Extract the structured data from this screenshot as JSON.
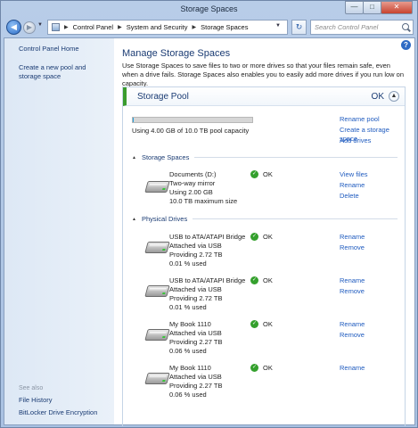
{
  "window": {
    "title": "Storage Spaces"
  },
  "address": {
    "crumbs": [
      "Control Panel",
      "System and Security",
      "Storage Spaces"
    ]
  },
  "search": {
    "placeholder": "Search Control Panel"
  },
  "left": {
    "home": "Control Panel Home",
    "create": "Create a new pool and storage space",
    "see_also": "See also",
    "file_history": "File History",
    "bitlocker": "BitLocker Drive Encryption"
  },
  "main": {
    "title": "Manage Storage Spaces",
    "description": "Use Storage Spaces to save files to two or more drives so that your files remain safe, even when a drive fails. Storage Spaces also enables you to easily add more drives if you run low on capacity."
  },
  "pool": {
    "title": "Storage Pool",
    "status": "OK",
    "capacity_text": "Using 4.00 GB of 10.0 TB pool capacity",
    "capacity_fraction": 0.0004,
    "actions": [
      "Rename pool",
      "Create a storage space",
      "Add drives"
    ]
  },
  "storage_spaces": {
    "header": "Storage Spaces",
    "items": [
      {
        "lines": [
          "Documents (D:)",
          "Two-way mirror",
          "Using 2.00 GB",
          "10.0 TB maximum size"
        ],
        "status": "OK",
        "actions": [
          "View files",
          "Rename",
          "Delete"
        ]
      }
    ]
  },
  "physical_drives": {
    "header": "Physical Drives",
    "items": [
      {
        "lines": [
          "USB to ATA/ATAPI Bridge",
          "Attached via USB",
          "Providing 2.72 TB",
          "0.01 % used"
        ],
        "status": "OK",
        "actions": [
          "Rename",
          "Remove"
        ]
      },
      {
        "lines": [
          "USB to ATA/ATAPI Bridge",
          "Attached via USB",
          "Providing 2.72 TB",
          "0.01 % used"
        ],
        "status": "OK",
        "actions": [
          "Rename",
          "Remove"
        ]
      },
      {
        "lines": [
          "My Book 1110",
          "Attached via USB",
          "Providing 2.27 TB",
          "0.06 % used"
        ],
        "status": "OK",
        "actions": [
          "Rename",
          "Remove"
        ]
      },
      {
        "lines": [
          "My Book 1110",
          "Attached via USB",
          "Providing 2.27 TB",
          "0.06 % used"
        ],
        "status": "OK",
        "actions": [
          "Rename"
        ]
      }
    ]
  },
  "colors": {
    "accent": "#3a9c2d",
    "link": "#1f5bbf",
    "heading": "#1a3b73",
    "progress": "#26a0da"
  },
  "icons": {
    "back": "back-arrow-icon",
    "forward": "forward-arrow-icon",
    "refresh": "refresh-icon",
    "search": "search-icon",
    "help": "help-icon",
    "drive": "hard-drive-icon",
    "ok": "check-icon"
  }
}
